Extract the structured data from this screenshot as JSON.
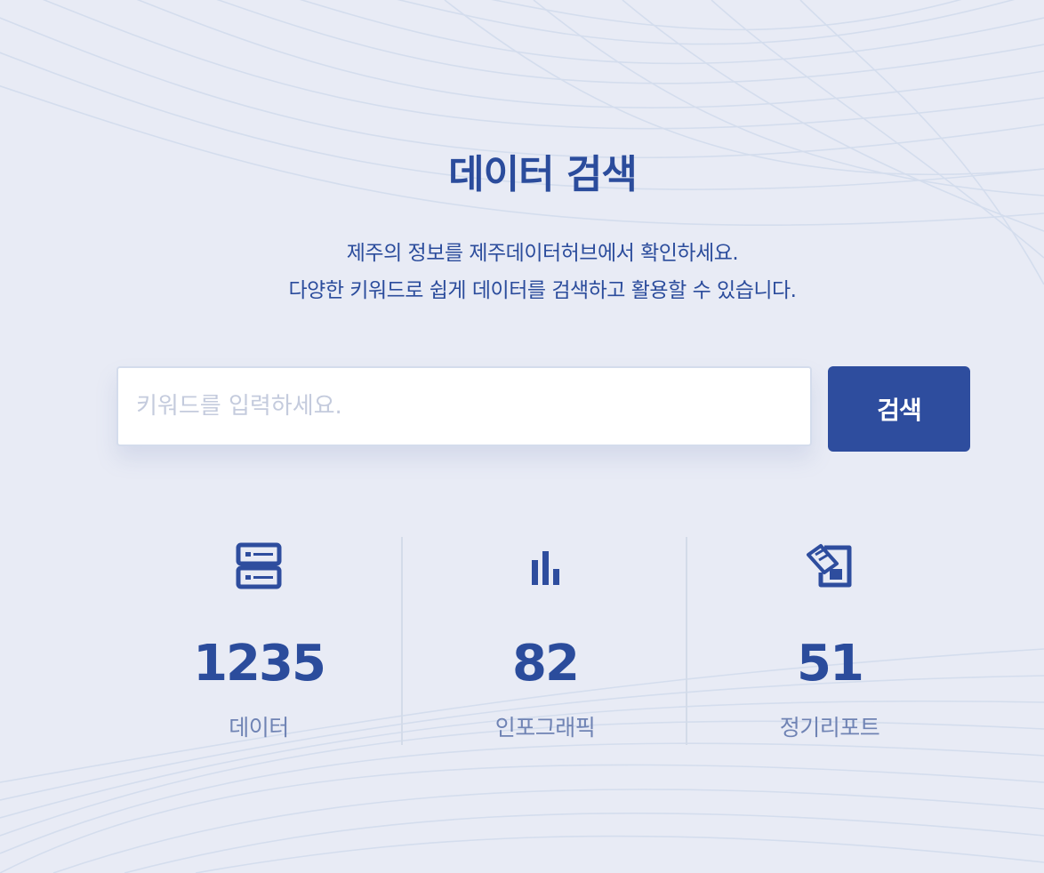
{
  "colors": {
    "background": "#e8ebf5",
    "accent": "#2e4d9e",
    "title": "#2b4c9c",
    "label": "#6f83b4",
    "divider": "#d3dbe9"
  },
  "header": {
    "title": "데이터 검색",
    "subtitle_line1": "제주의 정보를 제주데이터허브에서 확인하세요.",
    "subtitle_line2": "다양한 키워드로 쉽게 데이터를 검색하고 활용할 수 있습니다."
  },
  "search": {
    "placeholder": "키워드를 입력하세요.",
    "value": "",
    "button_label": "검색"
  },
  "stats": [
    {
      "icon": "server-icon",
      "value": "1235",
      "label": "데이터"
    },
    {
      "icon": "bar-chart-icon",
      "value": "82",
      "label": "인포그래픽"
    },
    {
      "icon": "report-icon",
      "value": "51",
      "label": "정기리포트"
    }
  ]
}
